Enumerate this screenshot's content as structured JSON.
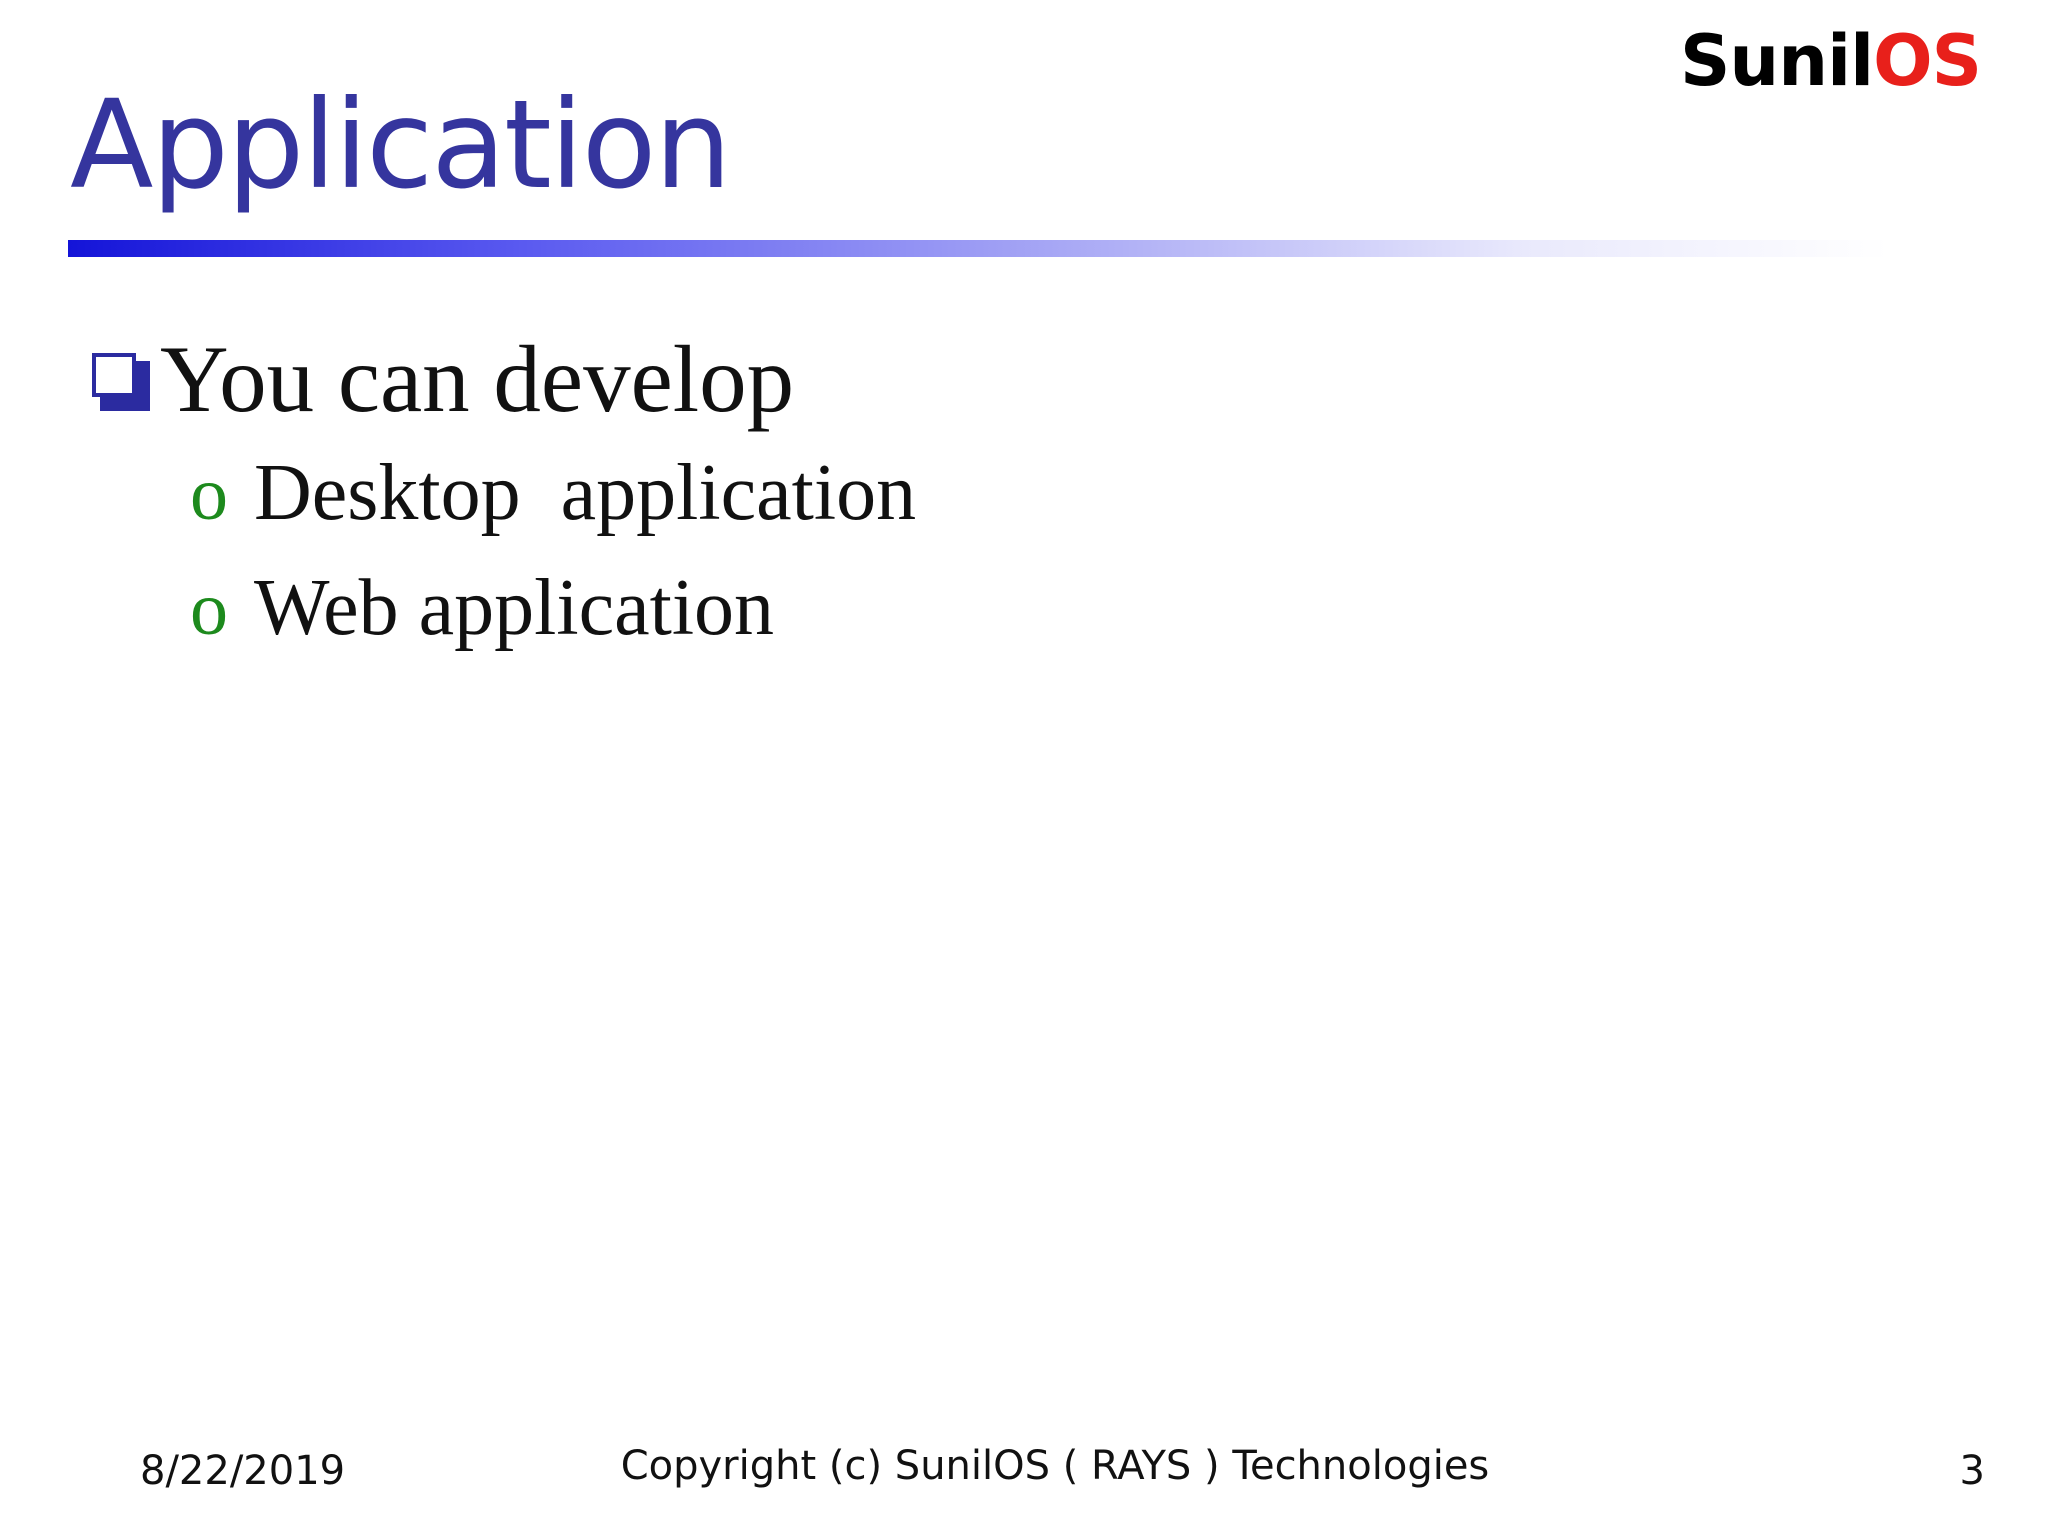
{
  "logo": {
    "part1": "Sunil",
    "part2": "OS"
  },
  "slide": {
    "title": "Application",
    "bullet": {
      "icon": "checkbox-square-icon",
      "text": "You can develop",
      "sub_items": [
        {
          "marker": "o",
          "text": "Desktop  application"
        },
        {
          "marker": "o",
          "text": "Web application"
        }
      ]
    }
  },
  "footer": {
    "date": "8/22/2019",
    "copyright": "Copyright (c) SunilOS ( RAYS ) Technologies",
    "page_number": "3"
  },
  "colors": {
    "title": "#35359e",
    "logo_black": "#000000",
    "logo_red": "#e8201b",
    "bullet_box": "#2b2ba0",
    "sub_marker": "#1d8a1d",
    "rule_start": "#1414d8"
  }
}
